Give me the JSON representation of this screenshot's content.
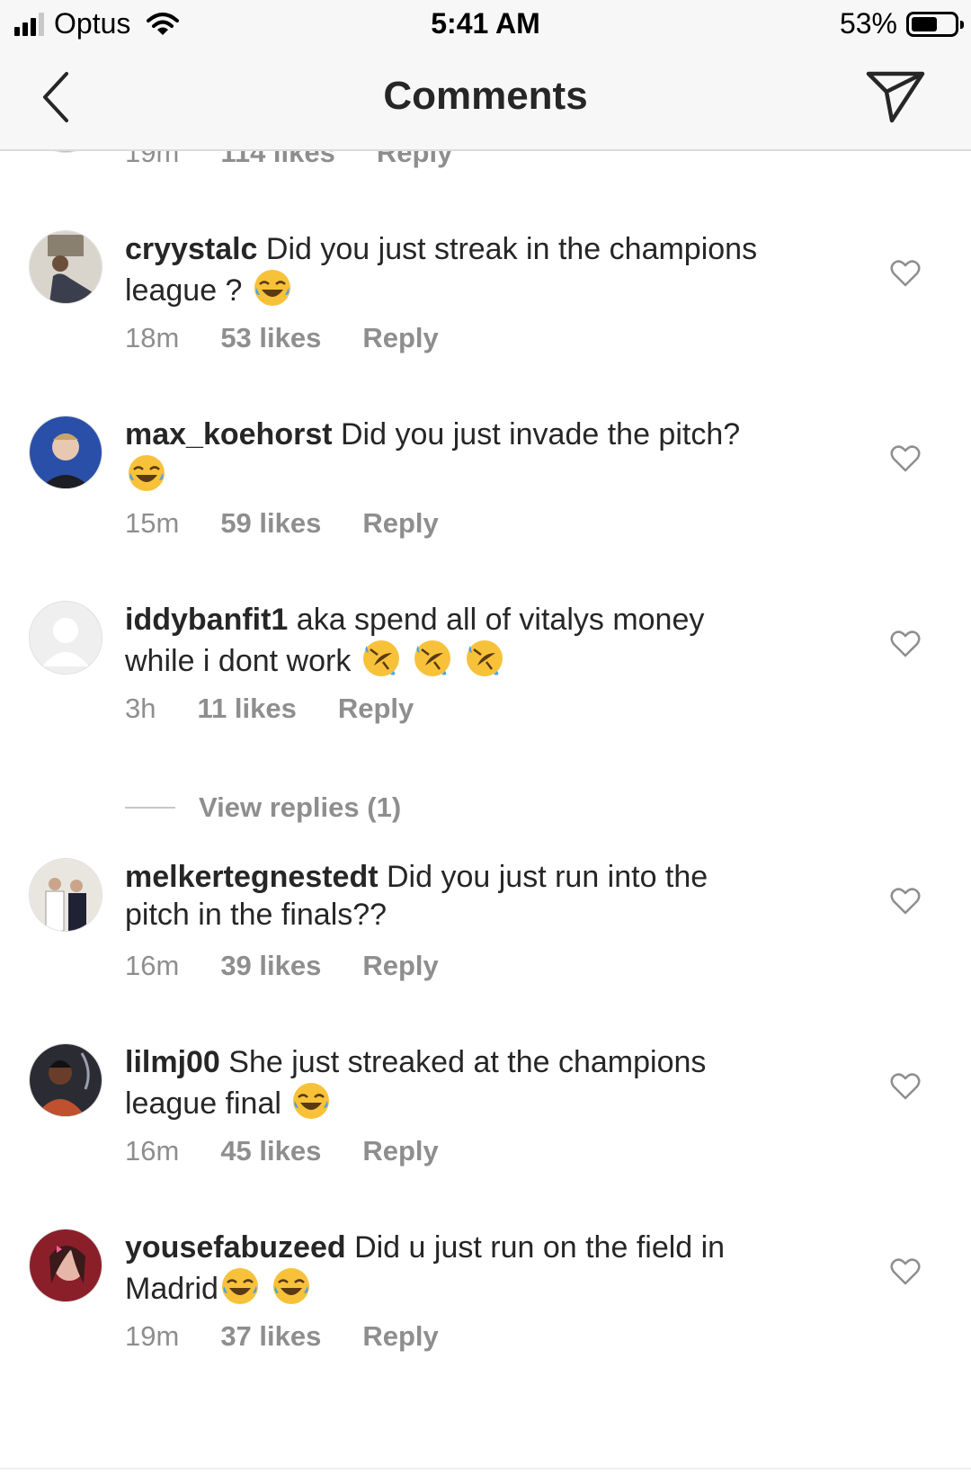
{
  "status_bar": {
    "carrier": "Optus",
    "time": "5:41 AM",
    "battery": "53%"
  },
  "nav": {
    "title": "Comments"
  },
  "partial_comment": {
    "time": "19m",
    "likes": "114 likes",
    "reply": "Reply"
  },
  "comments": [
    {
      "username": "cryystalc",
      "text_1": "Did you just streak in the champions",
      "text_2": "league ?",
      "emoji": "😂",
      "time": "18m",
      "likes": "53 likes",
      "reply": "Reply"
    },
    {
      "username": "max_koehorst",
      "text_1": "Did you just invade the pitch?",
      "emoji": "😂",
      "time": "15m",
      "likes": "59 likes",
      "reply": "Reply"
    },
    {
      "username": "iddybanfit1",
      "text_1": "aka spend all of vitalys money",
      "text_2": "while i dont work",
      "emoji": "🤣🤣🤣",
      "time": "3h",
      "likes": "11 likes",
      "reply": "Reply"
    },
    {
      "username": "melkertegnestedt",
      "text_1": "Did you just run into the",
      "text_2": "pitch in the finals??",
      "time": "16m",
      "likes": "39 likes",
      "reply": "Reply"
    },
    {
      "username": "lilmj00",
      "text_1": "She just streaked at the champions",
      "text_2": "league final",
      "emoji": "😂",
      "time": "16m",
      "likes": "45 likes",
      "reply": "Reply"
    },
    {
      "username": "yousefabuzeed",
      "text_1": "Did u just run on the field in",
      "text_2": "Madrid",
      "emoji": "😂😂",
      "time": "19m",
      "likes": "37 likes",
      "reply": "Reply"
    }
  ],
  "view_replies": "View replies (1)"
}
